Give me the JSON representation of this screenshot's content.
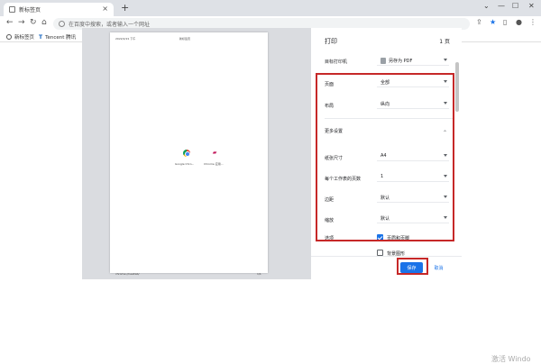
{
  "browser": {
    "tab_title": "新标签页",
    "new_tab_symbol": "+",
    "address_placeholder": "在百度中搜索，或者输入一个网址",
    "bookmarks": [
      {
        "label": "新标签页"
      },
      {
        "label": "Tencent 腾讯"
      }
    ]
  },
  "preview": {
    "date": "2022/2/21 下午",
    "title": "新标签页",
    "shortcut_1": "Google Chro...",
    "shortcut_2": "Chrome 应用...",
    "footer_left": "chrome://newtab/",
    "footer_right": "1/1"
  },
  "print": {
    "title": "打印",
    "page_count": "1 页",
    "destination_label": "目标打印机",
    "destination_value": "另存为 PDF",
    "pages_label": "页面",
    "pages_value": "全部",
    "layout_label": "布局",
    "layout_value": "纵向",
    "more_settings_label": "更多设置",
    "paper_size_label": "纸张尺寸",
    "paper_size_value": "A4",
    "pages_per_sheet_label": "每个工作表的页数",
    "pages_per_sheet_value": "1",
    "margins_label": "边距",
    "margins_value": "默认",
    "scale_label": "缩放",
    "scale_value": "默认",
    "options_label": "选项",
    "option_headers_footers": "页眉和页脚",
    "option_background": "背景图形",
    "save_button": "保存",
    "cancel_button": "取消"
  },
  "watermark": "激活 Windo",
  "colors": {
    "accent": "#1a73e8",
    "highlight": "#c62828"
  }
}
